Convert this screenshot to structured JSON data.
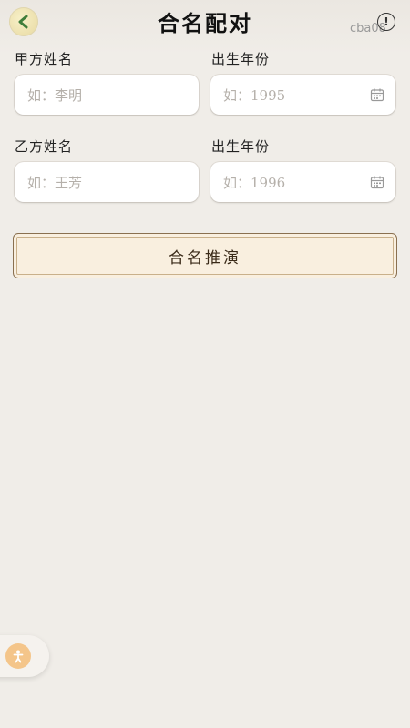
{
  "header": {
    "title": "合名配对",
    "watermark": "cba08",
    "info_symbol": "!",
    "back_icon": "chevron-left-icon"
  },
  "form": {
    "party_a": {
      "name_label": "甲方姓名",
      "name_placeholder": "如：李明",
      "year_label": "出生年份",
      "year_placeholder": "如：1995"
    },
    "party_b": {
      "name_label": "乙方姓名",
      "name_placeholder": "如：王芳",
      "year_label": "出生年份",
      "year_placeholder": "如：1996"
    },
    "submit_label": "合名推演"
  },
  "colors": {
    "accent_green": "#3f7d3a",
    "button_bg": "#f9efdf",
    "button_border": "#8a7050",
    "float_icon": "#f4c58a"
  }
}
